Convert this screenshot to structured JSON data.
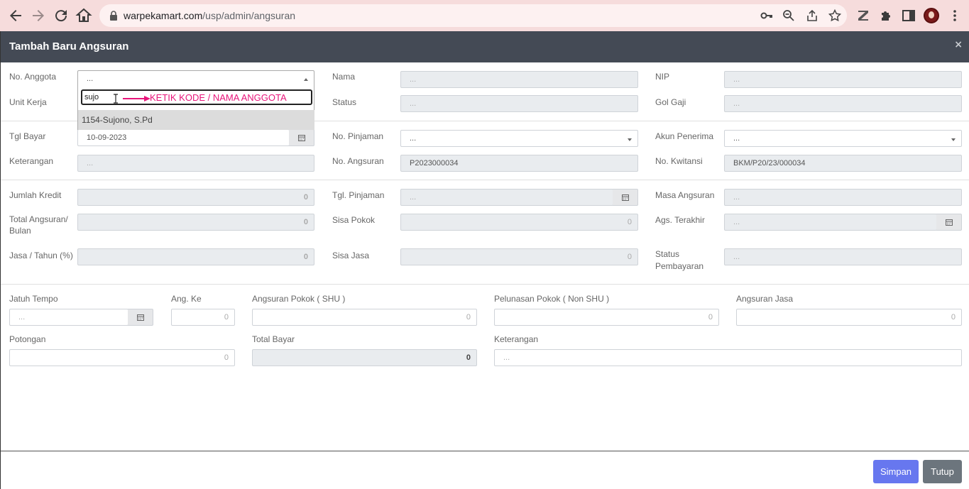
{
  "browser": {
    "url_host": "warpekamart.com",
    "url_path": "/usp/admin/angsuran"
  },
  "modal": {
    "title": "Tambah Baru Angsuran",
    "close_glyph": "×"
  },
  "section1": {
    "no_anggota": {
      "label": "No. Anggota",
      "value": "..."
    },
    "nama": {
      "label": "Nama",
      "value": "..."
    },
    "nip": {
      "label": "NIP",
      "value": "..."
    },
    "unit_kerja": {
      "label": "Unit Kerja"
    },
    "status": {
      "label": "Status",
      "value": "..."
    },
    "gol_gaji": {
      "label": "Gol Gaji",
      "value": "..."
    }
  },
  "dropdown": {
    "search_value": "sujo",
    "option": "1154-Sujono, S.Pd",
    "annotation": "KETIK KODE / NAMA ANGGOTA"
  },
  "section2": {
    "tgl_bayar": {
      "label": "Tgl Bayar",
      "value": "10-09-2023"
    },
    "no_pinjaman": {
      "label": "No. Pinjaman",
      "value": "..."
    },
    "akun_penerima": {
      "label": "Akun Penerima",
      "value": "..."
    },
    "keterangan": {
      "label": "Keterangan",
      "value": "..."
    },
    "no_angsuran": {
      "label": "No. Angsuran",
      "value": "P2023000034"
    },
    "no_kwitansi": {
      "label": "No. Kwitansi",
      "value": "BKM/P20/23/000034"
    }
  },
  "section3": {
    "jumlah_kredit": {
      "label": "Jumlah Kredit",
      "value": "0"
    },
    "tgl_pinjaman": {
      "label": "Tgl. Pinjaman",
      "value": "..."
    },
    "masa_angsuran": {
      "label": "Masa Angsuran",
      "value": "..."
    },
    "total_angsuran_1": "Total Angsuran/",
    "total_angsuran_2": "Bulan",
    "total_angsuran_value": "0",
    "sisa_pokok": {
      "label": "Sisa Pokok",
      "value": "0"
    },
    "ags_terakhir": {
      "label": "Ags. Terakhir",
      "value": "..."
    },
    "jasa_tahun": {
      "label": "Jasa / Tahun (%)",
      "value": "0"
    },
    "sisa_jasa": {
      "label": "Sisa Jasa",
      "value": "0"
    },
    "status_pembayaran_1": "Status",
    "status_pembayaran_2": "Pembayaran",
    "status_pembayaran_value": "..."
  },
  "section4": {
    "jatuh_tempo": {
      "label": "Jatuh Tempo",
      "value": "..."
    },
    "ang_ke": {
      "label": "Ang. Ke",
      "value": "0"
    },
    "angsuran_pokok": {
      "label": "Angsuran Pokok ( SHU )",
      "value": "0"
    },
    "pelunasan_pokok": {
      "label": "Pelunasan Pokok ( Non SHU )",
      "value": "0"
    },
    "angsuran_jasa": {
      "label": "Angsuran Jasa",
      "value": "0"
    },
    "potongan": {
      "label": "Potongan",
      "value": "0"
    },
    "total_bayar": {
      "label": "Total Bayar",
      "value": "0"
    },
    "keterangan": {
      "label": "Keterangan",
      "value": "..."
    }
  },
  "footer": {
    "save_label": "Simpan",
    "close_label": "Tutup"
  },
  "colors": {
    "header_bg": "#444a55",
    "primary": "#6777ef",
    "secondary": "#6c757d",
    "annotation": "#e8147a"
  }
}
